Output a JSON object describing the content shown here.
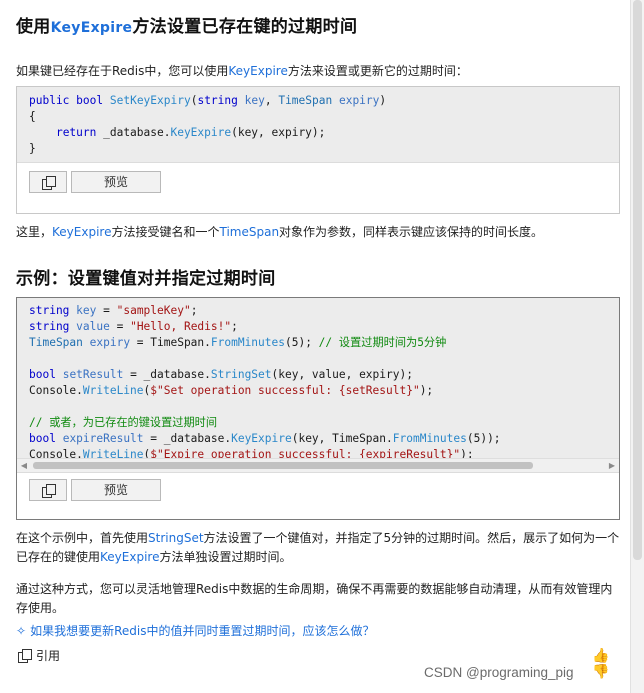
{
  "section1": {
    "title_pre": "使用",
    "title_kw": "KeyExpire",
    "title_post": "方法设置已存在键的过期时间",
    "intro_pre": "如果键已经存在于Redis中，您可以使用",
    "intro_kw": "KeyExpire",
    "intro_post": "方法来设置或更新它的过期时间：",
    "code": {
      "l1_kw1": "public",
      "l1_kw2": "bool",
      "l1_meth": "SetKeyExpiry",
      "l1_p1": "(",
      "l1_kw3": "string",
      "l1_id1": "key",
      "l1_p2": ", ",
      "l1_type": "TimeSpan",
      "l1_id2": "expiry",
      "l1_p3": ")",
      "l2": "{",
      "l3_indent": "    ",
      "l3_kw": "return",
      "l3_a": " _database.",
      "l3_meth": "KeyExpire",
      "l3_b": "(key, expiry);",
      "l4": "}"
    },
    "explain_pre": "这里，",
    "explain_kw1": "KeyExpire",
    "explain_mid": "方法接受键名和一个",
    "explain_kw2": "TimeSpan",
    "explain_post": "对象作为参数，同样表示键应该保持的时间长度。"
  },
  "section2": {
    "title": "示例：设置键值对并指定过期时间",
    "code": {
      "a1_kw": "string",
      "a1_id": "key",
      "a1_op": " = ",
      "a1_str": "\"sampleKey\"",
      "a1_end": ";",
      "a2_kw": "string",
      "a2_id": "value",
      "a2_op": " = ",
      "a2_str": "\"Hello, Redis!\"",
      "a2_end": ";",
      "a3_type": "TimeSpan",
      "a3_id": "expiry",
      "a3_op": " = TimeSpan.",
      "a3_meth": "FromMinutes",
      "a3_arg": "(5); ",
      "a3_com": "// 设置过期时间为5分钟",
      "b1_kw": "bool",
      "b1_id": "setResult",
      "b1_op": " = _database.",
      "b1_meth": "StringSet",
      "b1_arg": "(key, value, expiry);",
      "b2_a": "Console.",
      "b2_meth": "WriteLine",
      "b2_p": "(",
      "b2_str": "$\"Set operation successful: {setResult}\"",
      "b2_end": ");",
      "c0_com": "// 或者，为已存在的键设置过期时间",
      "c1_kw": "bool",
      "c1_id": "expireResult",
      "c1_op": " = _database.",
      "c1_meth": "KeyExpire",
      "c1_a": "(key, TimeSpan.",
      "c1_meth2": "FromMinutes",
      "c1_b": "(5));",
      "c2_a": "Console.",
      "c2_meth": "WriteLine",
      "c2_p": "(",
      "c2_str": "$\"Expire operation successful: {expireResult}\"",
      "c2_end": ");"
    },
    "para1_pre": "在这个示例中，首先使用",
    "para1_kw1": "StringSet",
    "para1_mid": "方法设置了一个键值对，并指定了5分钟的过期时间。然后，展示了如何为一个已存在的键使用",
    "para1_kw2": "KeyExpire",
    "para1_post": "方法单独设置过期时间。",
    "para2": "通过这种方式，您可以灵活地管理Redis中数据的生命周期，确保不再需要的数据能够自动清理，从而有效管理内存使用。"
  },
  "toolbar": {
    "preview_label": "预览"
  },
  "scrollbar": {
    "left_arrow": "◀",
    "right_arrow": "▶"
  },
  "suggestion": {
    "icon": "sparkle-icon",
    "text": "如果我想要更新Redis中的值并同时重置过期时间，应该怎么做？"
  },
  "cite": {
    "label": "引用"
  },
  "watermark": "CSDN @programing_pig",
  "colors": {
    "accent": "#1e6fd9",
    "code_bg": "#ececec",
    "comment": "#118a11",
    "string": "#a31515"
  }
}
